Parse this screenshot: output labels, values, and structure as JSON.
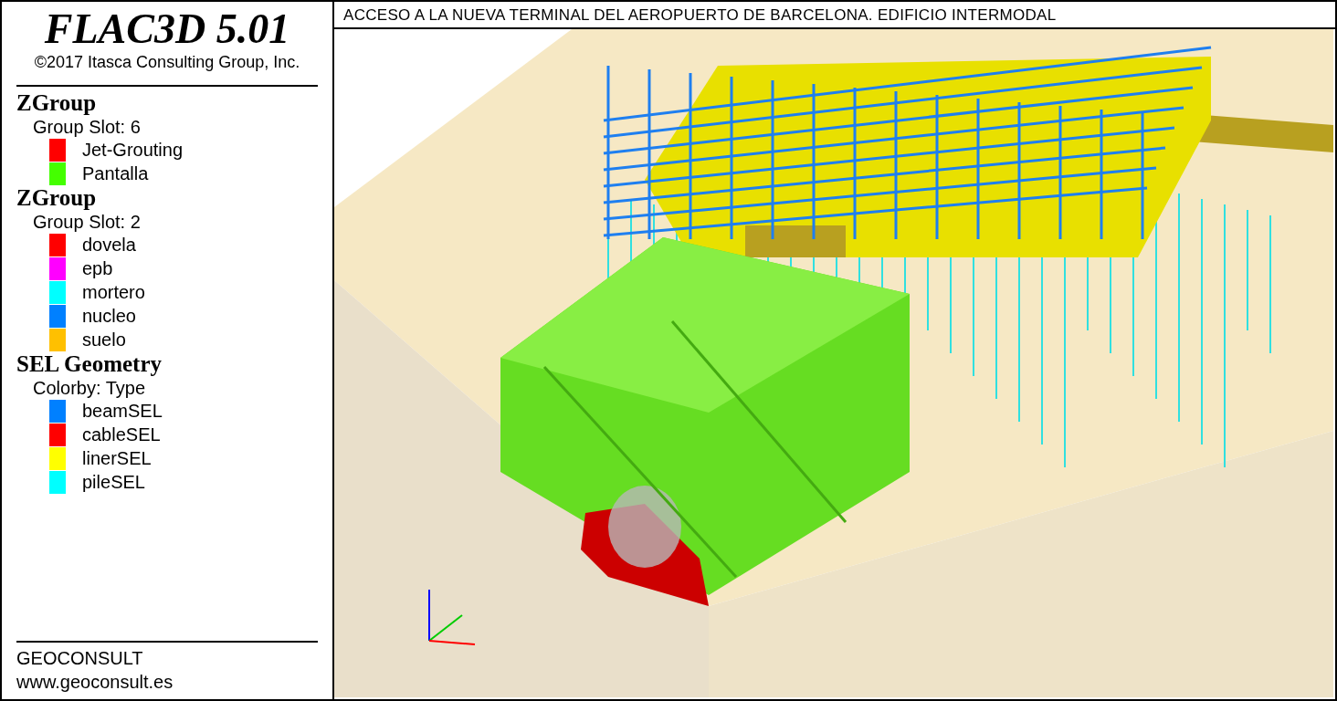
{
  "app": {
    "title": "FLAC3D 5.01",
    "copyright": "©2017 Itasca Consulting Group, Inc."
  },
  "legend": [
    {
      "heading": "ZGroup",
      "subheading": "Group Slot: 6",
      "items": [
        {
          "label": "Jet-Grouting",
          "color": "#ff0000"
        },
        {
          "label": "Pantalla",
          "color": "#44ff00"
        }
      ]
    },
    {
      "heading": "ZGroup",
      "subheading": "Group Slot: 2",
      "items": [
        {
          "label": "dovela",
          "color": "#ff0000"
        },
        {
          "label": "epb",
          "color": "#ff00ff"
        },
        {
          "label": "mortero",
          "color": "#00ffff"
        },
        {
          "label": "nucleo",
          "color": "#0080ff"
        },
        {
          "label": "suelo",
          "color": "#ffc000"
        }
      ]
    },
    {
      "heading": "SEL Geometry",
      "subheading": "Colorby: Type",
      "items": [
        {
          "label": "beamSEL",
          "color": "#0080ff"
        },
        {
          "label": "cableSEL",
          "color": "#ff0000"
        },
        {
          "label": "linerSEL",
          "color": "#ffff00"
        },
        {
          "label": "pileSEL",
          "color": "#00ffff"
        }
      ]
    }
  ],
  "footer": [
    "GEOCONSULT",
    "www.geoconsult.es"
  ],
  "viewport": {
    "title": "ACCESO A LA NUEVA TERMINAL DEL AEROPUERTO DE BARCELONA. EDIFICIO INTERMODAL"
  }
}
